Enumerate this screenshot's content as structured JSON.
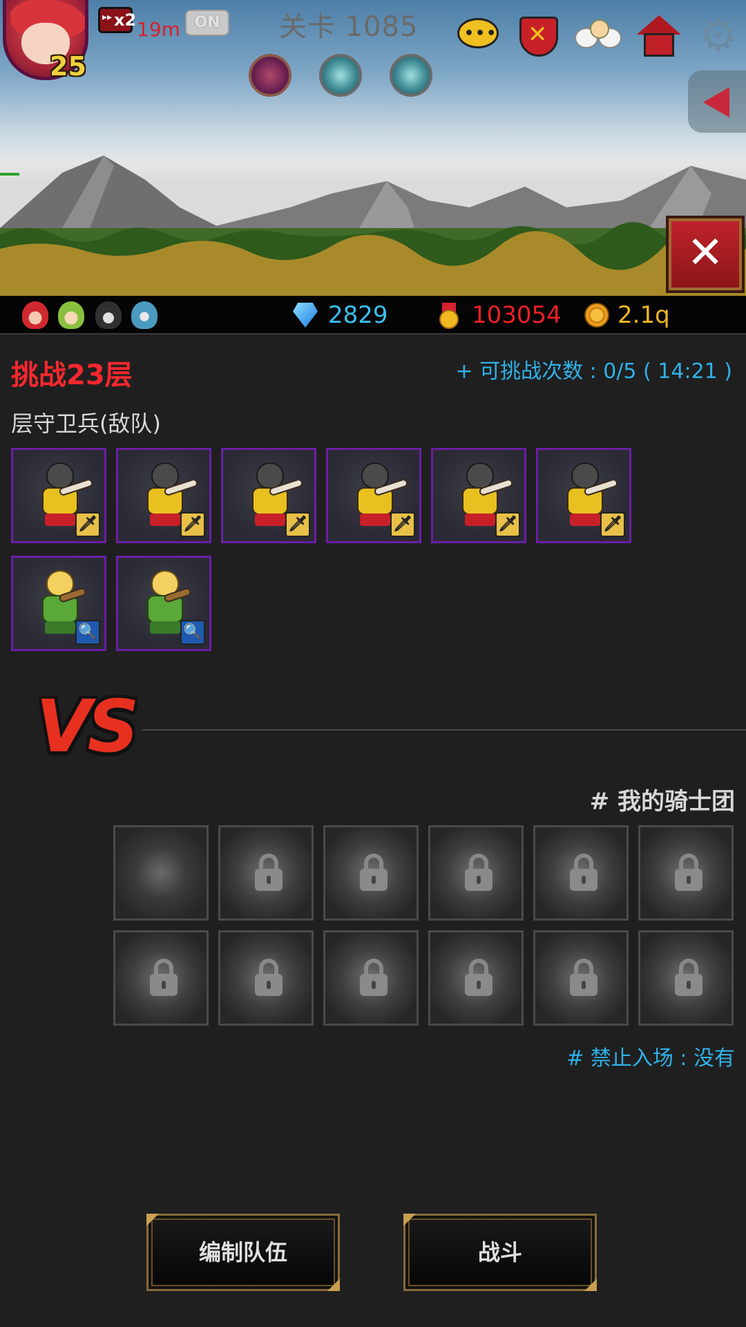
{
  "hud": {
    "player_level": "25",
    "speed_multiplier": "x2",
    "speed_time": "19m",
    "auto_toggle": "ON",
    "stage_title": "关卡 1085"
  },
  "icons": {
    "avatar": "hero-portrait",
    "speed": "fast-forward-icon",
    "chat": "chat-bubble-icon",
    "battle": "crossed-swords-shield-icon",
    "angel": "angel-icon",
    "house": "house-icon",
    "settings": "gear-icon",
    "side_tab": "triangle-left-icon",
    "close": "close-icon"
  },
  "resources": {
    "gems": "2829",
    "medals": "103054",
    "gold": "2.1q"
  },
  "challenge": {
    "title": "挑战23层",
    "attempts": "+ 可挑战次数 : 0/5 ( 14:21 )",
    "enemy_label": "层守卫兵(敌队)"
  },
  "enemy_units": [
    {
      "type": "guard",
      "class": "sword"
    },
    {
      "type": "guard",
      "class": "sword"
    },
    {
      "type": "guard",
      "class": "sword"
    },
    {
      "type": "guard",
      "class": "sword"
    },
    {
      "type": "guard",
      "class": "sword"
    },
    {
      "type": "guard",
      "class": "sword"
    },
    {
      "type": "elf",
      "class": "magnifier"
    },
    {
      "type": "elf",
      "class": "magnifier"
    }
  ],
  "vs_text": "VS",
  "my_team": {
    "label": "# 我的骑士团",
    "slots_total": 12,
    "locked_slots": 11,
    "banned": "# 禁止入场 : 没有"
  },
  "buttons": {
    "edit_team": "编制队伍",
    "fight": "战斗"
  },
  "colors": {
    "challenge_red": "#f5282e",
    "info_blue": "#2fb2e8",
    "gem_blue": "#3cc0f0",
    "medal_red": "#ef2026",
    "gold_yellow": "#f2b521",
    "enemy_frame": "#6a1ea6"
  }
}
